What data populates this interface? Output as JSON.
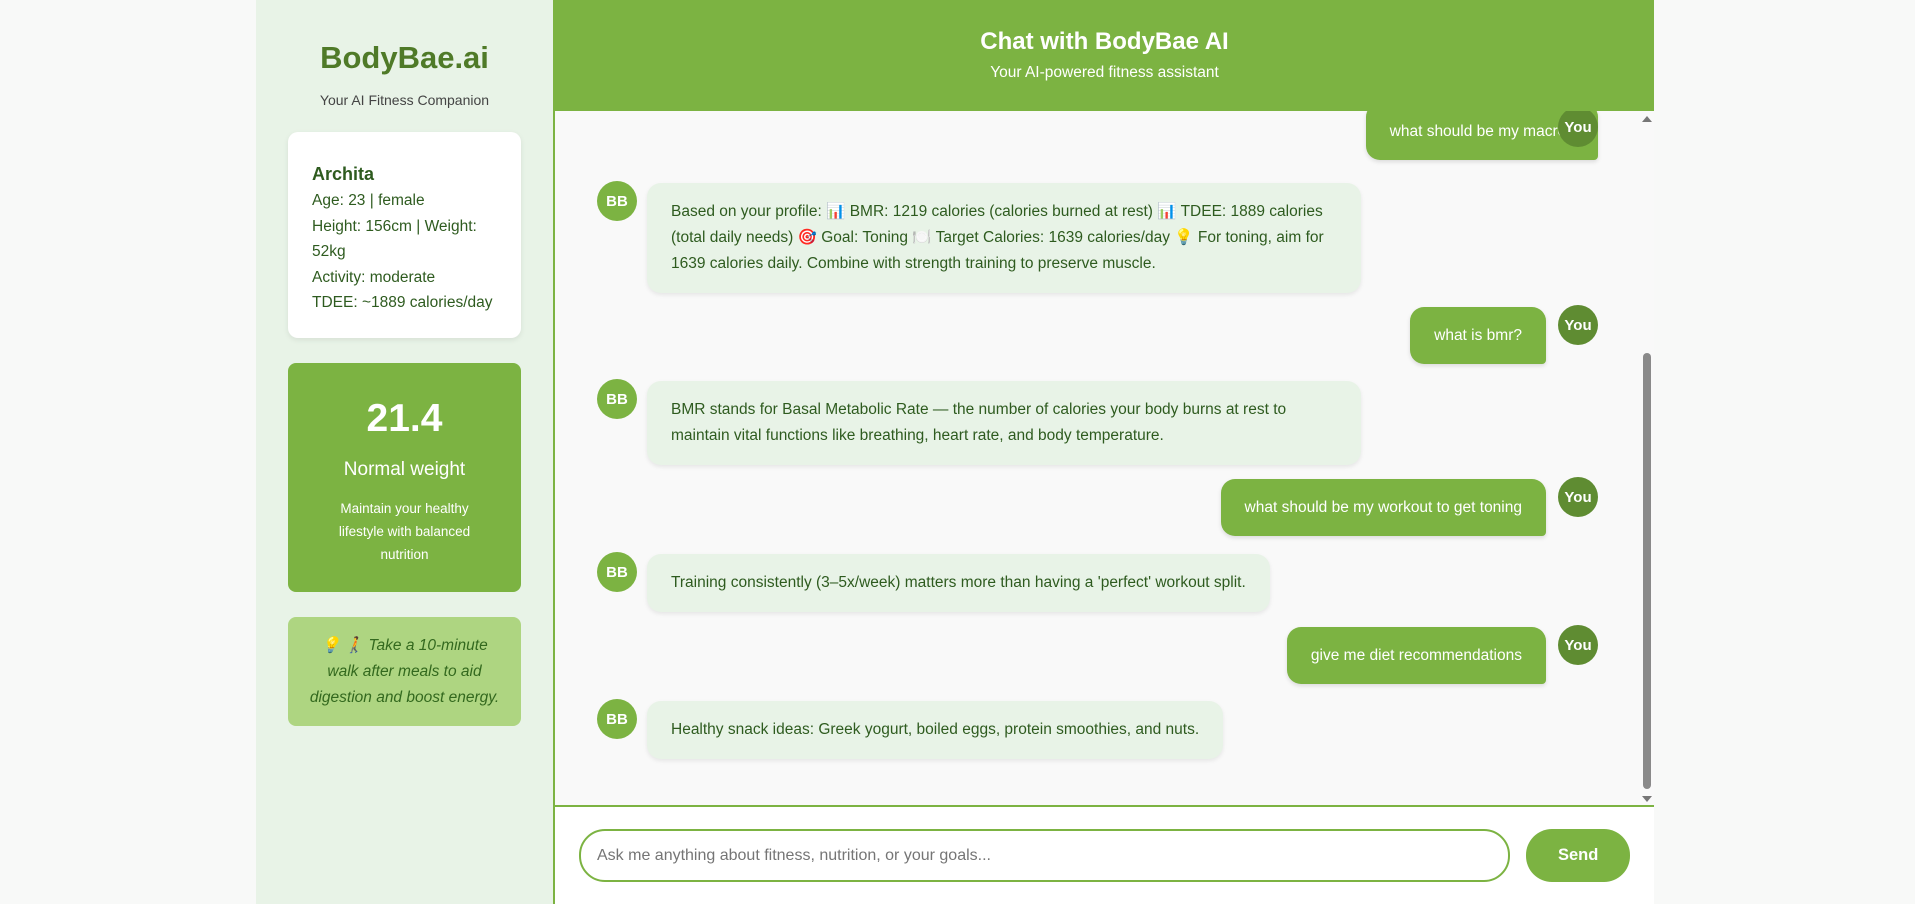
{
  "sidebar": {
    "brand": "BodyBae.ai",
    "tagline": "Your AI Fitness Companion",
    "profile": {
      "name": "Archita",
      "age_line": "Age: 23 | female",
      "height_weight_line": "Height: 156cm | Weight: 52kg",
      "activity_line": "Activity: moderate",
      "tdee_line": "TDEE: ~1889 calories/day"
    },
    "bmi": {
      "value": "21.4",
      "category": "Normal weight",
      "advice": "Maintain your healthy lifestyle with balanced nutrition"
    },
    "tip": "💡 🚶 Take a 10-minute walk after meals to aid digestion and boost energy."
  },
  "header": {
    "title": "Chat with BodyBae AI",
    "subtitle": "Your AI-powered fitness assistant"
  },
  "chat": {
    "user_avatar_label": "You",
    "bot_avatar_label": "BB",
    "messages": [
      {
        "sender": "user",
        "text": "what should be my macros"
      },
      {
        "sender": "bot",
        "text": "Based on your profile: 📊 BMR: 1219 calories (calories burned at rest) 📊 TDEE: 1889 calories (total daily needs) 🎯 Goal: Toning 🍽️ Target Calories: 1639 calories/day 💡 For toning, aim for 1639 calories daily. Combine with strength training to preserve muscle."
      },
      {
        "sender": "user",
        "text": "what is bmr?"
      },
      {
        "sender": "bot",
        "text": "BMR stands for Basal Metabolic Rate — the number of calories your body burns at rest to maintain vital functions like breathing, heart rate, and body temperature."
      },
      {
        "sender": "user",
        "text": "what should be my workout to get toning"
      },
      {
        "sender": "bot",
        "text": "Training consistently (3–5x/week) matters more than having a 'perfect' workout split."
      },
      {
        "sender": "user",
        "text": "give me diet recommendations"
      },
      {
        "sender": "bot",
        "text": "Healthy snack ideas: Greek yogurt, boiled eggs, protein smoothies, and nuts."
      }
    ]
  },
  "input": {
    "placeholder": "Ask me anything about fitness, nutrition, or your goals...",
    "send_label": "Send"
  },
  "colors": {
    "primary": "#7cb342",
    "dark_green": "#2e5b1f",
    "sidebar_bg": "#e8f3e7",
    "tip_bg": "#aed581"
  }
}
